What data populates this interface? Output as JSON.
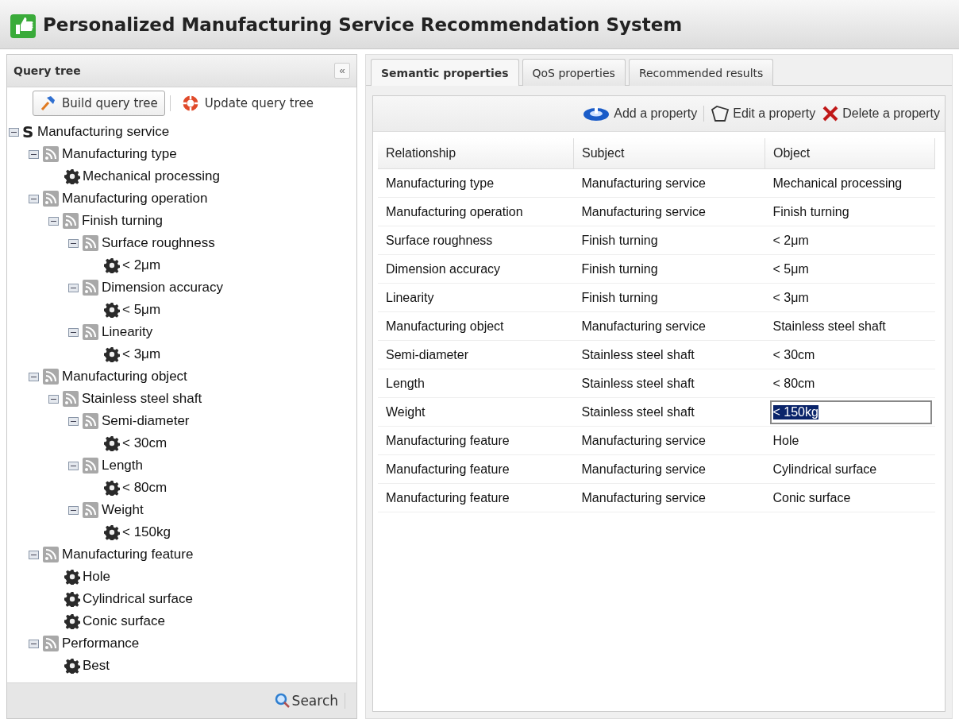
{
  "window": {
    "title": "Personalized Manufacturing Service Recommendation System"
  },
  "query_panel": {
    "title": "Query tree",
    "collapse": "«",
    "toolbar": [
      {
        "kind": "build",
        "label": "Build query tree",
        "bordered": true
      },
      {
        "kind": "update",
        "label": "Update query tree",
        "bordered": false
      }
    ],
    "tree": [
      {
        "kind": "root",
        "badge": "S",
        "label": "Manufacturing service",
        "expanded": true,
        "children": [
          {
            "kind": "property",
            "label": "Manufacturing type",
            "expanded": true,
            "children": [
              {
                "kind": "value",
                "label": "Mechanical processing"
              }
            ]
          },
          {
            "kind": "property",
            "label": "Manufacturing operation",
            "expanded": true,
            "children": [
              {
                "kind": "property",
                "label": "Finish turning",
                "expanded": true,
                "children": [
                  {
                    "kind": "property",
                    "label": "Surface roughness",
                    "expanded": true,
                    "children": [
                      {
                        "kind": "value",
                        "label": "< 2μm"
                      }
                    ]
                  },
                  {
                    "kind": "property",
                    "label": "Dimension accuracy",
                    "expanded": true,
                    "children": [
                      {
                        "kind": "value",
                        "label": "< 5μm"
                      }
                    ]
                  },
                  {
                    "kind": "property",
                    "label": "Linearity",
                    "expanded": true,
                    "children": [
                      {
                        "kind": "value",
                        "label": "< 3μm"
                      }
                    ]
                  }
                ]
              }
            ]
          },
          {
            "kind": "property",
            "label": "Manufacturing object",
            "expanded": true,
            "children": [
              {
                "kind": "property",
                "label": "Stainless steel shaft",
                "expanded": true,
                "children": [
                  {
                    "kind": "property",
                    "label": "Semi-diameter",
                    "expanded": true,
                    "children": [
                      {
                        "kind": "value",
                        "label": "< 30cm"
                      }
                    ]
                  },
                  {
                    "kind": "property",
                    "label": "Length",
                    "expanded": true,
                    "children": [
                      {
                        "kind": "value",
                        "label": "< 80cm"
                      }
                    ]
                  },
                  {
                    "kind": "property",
                    "label": "Weight",
                    "expanded": true,
                    "children": [
                      {
                        "kind": "value",
                        "label": "< 150kg"
                      }
                    ]
                  }
                ]
              }
            ]
          },
          {
            "kind": "property",
            "label": "Manufacturing feature",
            "expanded": true,
            "children": [
              {
                "kind": "value",
                "label": "Hole"
              },
              {
                "kind": "value",
                "label": "Cylindrical surface"
              },
              {
                "kind": "value",
                "label": "Conic surface"
              }
            ]
          },
          {
            "kind": "property",
            "label": "Performance",
            "expanded": true,
            "children": [
              {
                "kind": "value",
                "label": "Best"
              }
            ]
          }
        ]
      }
    ],
    "footer": {
      "search": "Search"
    }
  },
  "tabs": [
    {
      "label": "Semantic properties",
      "selected": true
    },
    {
      "label": "QoS properties",
      "selected": false
    },
    {
      "label": "Recommended results",
      "selected": false
    }
  ],
  "toolbar": [
    {
      "kind": "add",
      "label": "Add a property"
    },
    {
      "kind": "edit",
      "label": "Edit a property"
    },
    {
      "kind": "delete",
      "label": "Delete a property"
    }
  ],
  "table": {
    "columns": [
      "Relationship",
      "Subject",
      "Object"
    ],
    "rows": [
      {
        "cells": [
          "Manufacturing type",
          "Manufacturing service",
          "Mechanical processing"
        ],
        "editing": false
      },
      {
        "cells": [
          "Manufacturing operation",
          "Manufacturing service",
          "Finish turning"
        ],
        "editing": false
      },
      {
        "cells": [
          "Surface roughness",
          "Finish turning",
          "< 2μm"
        ],
        "editing": false
      },
      {
        "cells": [
          "Dimension accuracy",
          "Finish turning",
          "< 5μm"
        ],
        "editing": false
      },
      {
        "cells": [
          "Linearity",
          "Finish turning",
          "< 3μm"
        ],
        "editing": false
      },
      {
        "cells": [
          "Manufacturing object",
          "Manufacturing service",
          "Stainless steel shaft"
        ],
        "editing": false
      },
      {
        "cells": [
          "Semi-diameter",
          "Stainless steel shaft",
          "< 30cm"
        ],
        "editing": false
      },
      {
        "cells": [
          "Length",
          "Stainless steel shaft",
          "< 80cm"
        ],
        "editing": false
      },
      {
        "cells": [
          "Weight",
          "Stainless steel shaft",
          "< 150kg"
        ],
        "editing": true
      },
      {
        "cells": [
          "Manufacturing feature",
          "Manufacturing service",
          "Hole"
        ],
        "editing": false
      },
      {
        "cells": [
          "Manufacturing feature",
          "Manufacturing service",
          "Cylindrical surface"
        ],
        "editing": false
      },
      {
        "cells": [
          "Manufacturing feature",
          "Manufacturing service",
          "Conic surface"
        ],
        "editing": false
      }
    ]
  }
}
